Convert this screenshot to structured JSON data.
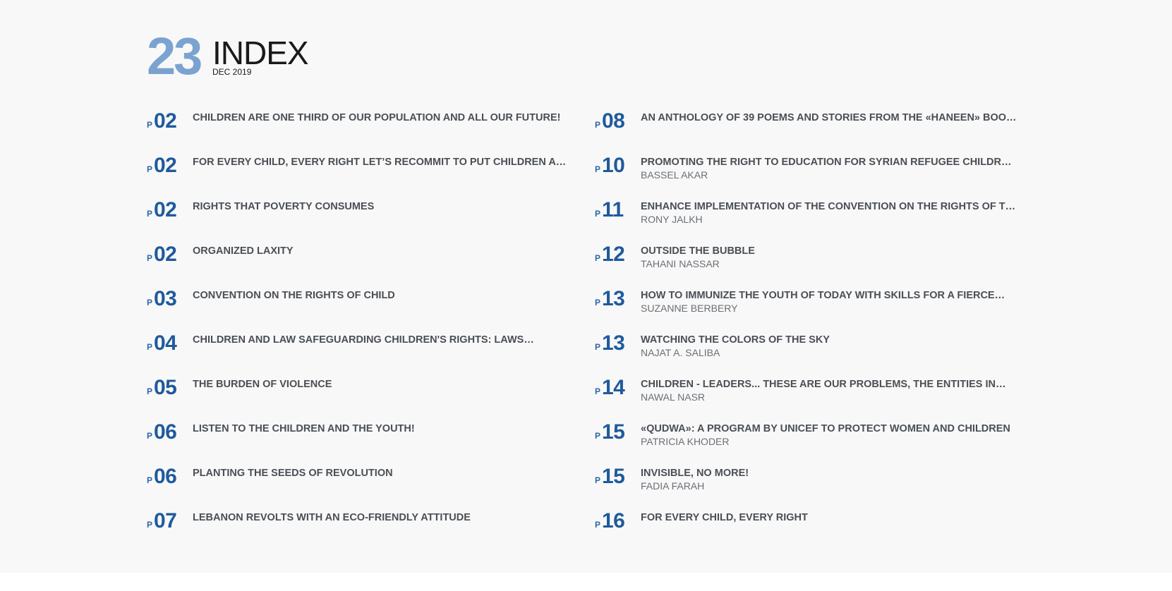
{
  "header": {
    "issue_number": "23",
    "title": "INDEX",
    "date": "DEC 2019"
  },
  "page_prefix": "P",
  "left_column": [
    {
      "page": "02",
      "title": "CHILDREN ARE ONE THIRD OF OUR POPULATION AND ALL OUR FUTURE!",
      "author": ""
    },
    {
      "page": "02",
      "title": "FOR EVERY CHILD, EVERY RIGHT LET’S RECOMMIT TO PUT CHILDREN AND…",
      "author": ""
    },
    {
      "page": "02",
      "title": "RIGHTS THAT POVERTY CONSUMES",
      "author": ""
    },
    {
      "page": "02",
      "title": "ORGANIZED LAXITY",
      "author": ""
    },
    {
      "page": "03",
      "title": "CONVENTION ON THE RIGHTS OF CHILD",
      "author": ""
    },
    {
      "page": "04",
      "title": "CHILDREN AND LAW SAFEGUARDING CHILDREN'S RIGHTS: LAWS…",
      "author": ""
    },
    {
      "page": "05",
      "title": "THE BURDEN OF VIOLENCE",
      "author": ""
    },
    {
      "page": "06",
      "title": "LISTEN TO THE CHILDREN AND THE YOUTH!",
      "author": ""
    },
    {
      "page": "06",
      "title": "PLANTING THE SEEDS OF REVOLUTION",
      "author": ""
    },
    {
      "page": "07",
      "title": "LEBANON REVOLTS WITH AN ECO-FRIENDLY ATTITUDE",
      "author": ""
    }
  ],
  "right_column": [
    {
      "page": "08",
      "title": "AN ANTHOLOGY OF 39 POEMS AND STORIES FROM THE «HANEEN» BOOK…",
      "author": ""
    },
    {
      "page": "10",
      "title": "PROMOTING THE RIGHT TO EDUCATION FOR SYRIAN REFUGEE CHILDREN…",
      "author": "BASSEL AKAR"
    },
    {
      "page": "11",
      "title": "ENHANCE IMPLEMENTATION OF THE CONVENTION ON THE RIGHTS OF T…",
      "author": "RONY JALKH"
    },
    {
      "page": "12",
      "title": "OUTSIDE THE BUBBLE",
      "author": "TAHANI NASSAR"
    },
    {
      "page": "13",
      "title": "HOW TO IMMUNIZE THE YOUTH OF TODAY WITH SKILLS FOR A FIERCE…",
      "author": "SUZANNE BERBERY"
    },
    {
      "page": "13",
      "title": "WATCHING THE COLORS OF THE SKY",
      "author": "NAJAT A. SALIBA"
    },
    {
      "page": "14",
      "title": "CHILDREN - LEADERS... THESE ARE OUR PROBLEMS, THE ENTITIES IN…",
      "author": "NAWAL NASR"
    },
    {
      "page": "15",
      "title": "«QUDWA»: A PROGRAM BY UNICEF TO PROTECT WOMEN AND CHILDREN",
      "author": "PATRICIA KHODER"
    },
    {
      "page": "15",
      "title": "INVISIBLE, NO MORE!",
      "author": "FADIA FARAH"
    },
    {
      "page": "16",
      "title": "FOR EVERY CHILD, EVERY RIGHT",
      "author": ""
    }
  ],
  "colors": {
    "issue_number": "#7ba3cf",
    "page_number": "#1f5a9c",
    "title_text": "#4a4f55",
    "author_text": "#6a6f75",
    "background": "#f8f8f8"
  }
}
